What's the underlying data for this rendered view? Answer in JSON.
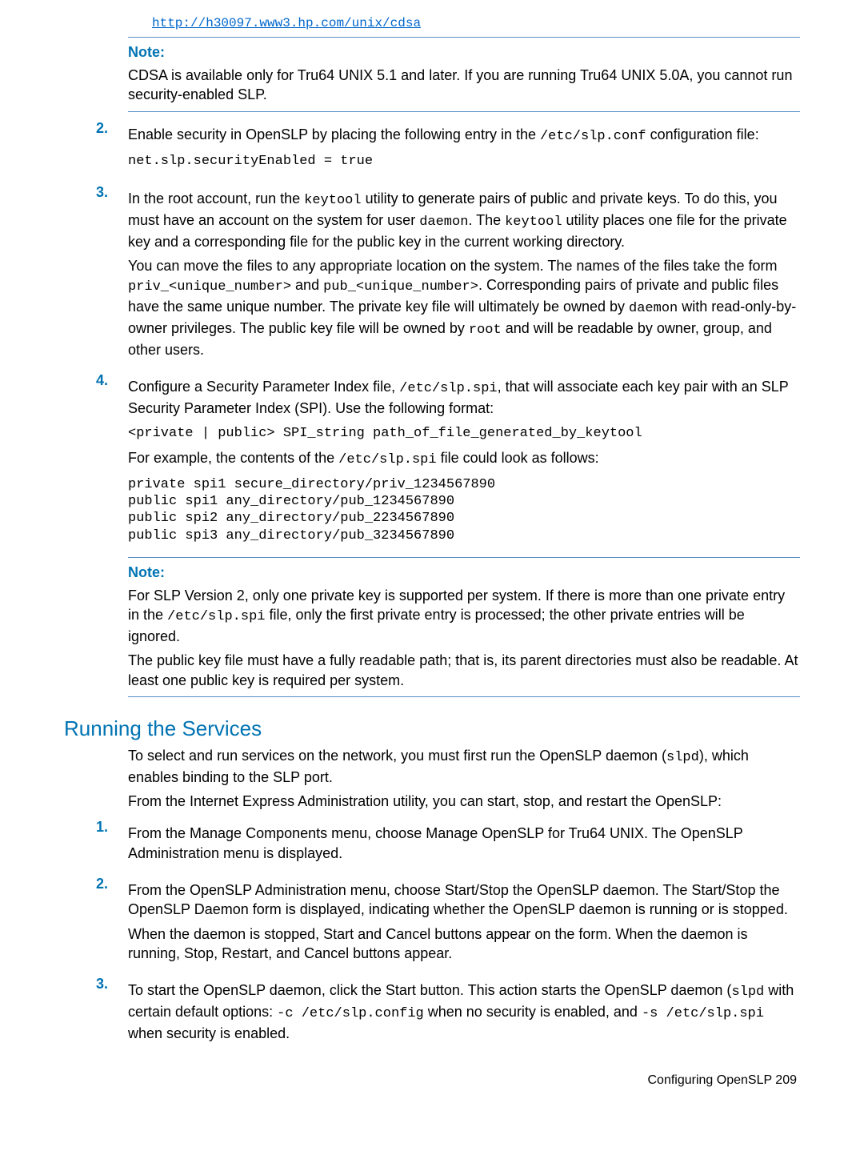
{
  "top_link": "http://h30097.www3.hp.com/unix/cdsa",
  "note1": {
    "title": "Note:",
    "text": "CDSA is available only for Tru64 UNIX 5.1 and later. If you are running Tru64 UNIX 5.0A, you cannot run security-enabled SLP."
  },
  "step2": {
    "num": "2.",
    "text_a": "Enable security in OpenSLP by placing the following entry in the ",
    "code_a": "/etc/slp.conf",
    "text_b": " configuration file:",
    "codeblock": "net.slp.securityEnabled = true"
  },
  "step3": {
    "num": "3.",
    "p1_a": "In the root account, run the ",
    "p1_code1": "keytool",
    "p1_b": " utility to generate pairs of public and private keys. To do this, you must have an account on the system for user ",
    "p1_code2": "daemon",
    "p1_c": ". The ",
    "p1_code3": "keytool",
    "p1_d": " utility places one file for the private key and a corresponding file for the public key in the current working directory.",
    "p2_a": "You can move the files to any appropriate location on the system. The names of the files take the form ",
    "p2_code1": "priv_<unique_number>",
    "p2_b": " and ",
    "p2_code2": "pub_<unique_number>",
    "p2_c": ". Corresponding pairs of private and public files have the same unique number. The private key file will ultimately be owned by ",
    "p2_code3": "daemon",
    "p2_d": " with read-only-by-owner privileges. The public key file will be owned by ",
    "p2_code4": "root",
    "p2_e": " and will be readable by owner, group, and other users."
  },
  "step4": {
    "num": "4.",
    "p1_a": "Configure a Security Parameter Index file, ",
    "p1_code1": "/etc/slp.spi",
    "p1_b": ", that will associate each key pair with an SLP Security Parameter Index (SPI). Use the following format:",
    "codeblock1": "<private | public> SPI_string path_of_file_generated_by_keytool",
    "p2_a": "For example, the contents of the ",
    "p2_code1": "/etc/slp.spi",
    "p2_b": " file could look as follows:",
    "codeblock2": "private spi1 secure_directory/priv_1234567890\npublic spi1 any_directory/pub_1234567890\npublic spi2 any_directory/pub_2234567890\npublic spi3 any_directory/pub_3234567890"
  },
  "note2": {
    "title": "Note:",
    "p1_a": "For SLP Version 2, only one private key is supported per system. If there is more than one private entry in the ",
    "p1_code1": "/etc/slp.spi",
    "p1_b": " file, only the first private entry is processed; the other private entries will be ignored.",
    "p2": "The public key file must have a fully readable path; that is, its parent directories must also be readable. At least one public key is required per system."
  },
  "section_title": "Running the Services",
  "services": {
    "p1_a": "To select and run services on the network, you must first run the OpenSLP daemon (",
    "p1_code1": "slpd",
    "p1_b": "), which enables binding to the SLP port.",
    "p2": "From the Internet Express Administration utility, you can start, stop, and restart the OpenSLP:"
  },
  "svc1": {
    "num": "1.",
    "text": "From the Manage Components menu, choose Manage OpenSLP for Tru64 UNIX. The OpenSLP Administration menu is displayed."
  },
  "svc2": {
    "num": "2.",
    "p1": "From the OpenSLP Administration menu, choose Start/Stop the OpenSLP daemon. The Start/Stop the OpenSLP Daemon form is displayed, indicating whether the OpenSLP daemon is running or is stopped.",
    "p2": "When the daemon is stopped, Start and Cancel buttons appear on the form. When the daemon is running, Stop, Restart, and Cancel buttons appear."
  },
  "svc3": {
    "num": "3.",
    "p1_a": "To start the OpenSLP daemon, click the Start button. This action starts the OpenSLP daemon (",
    "p1_code1": "slpd",
    "p1_b": " with certain default options: ",
    "p1_code2": "-c /etc/slp.config",
    "p1_c": " when no security is enabled, and ",
    "p1_code3": "-s /etc/slp.spi",
    "p1_d": " when security is enabled."
  },
  "footer": "Configuring OpenSLP   209"
}
